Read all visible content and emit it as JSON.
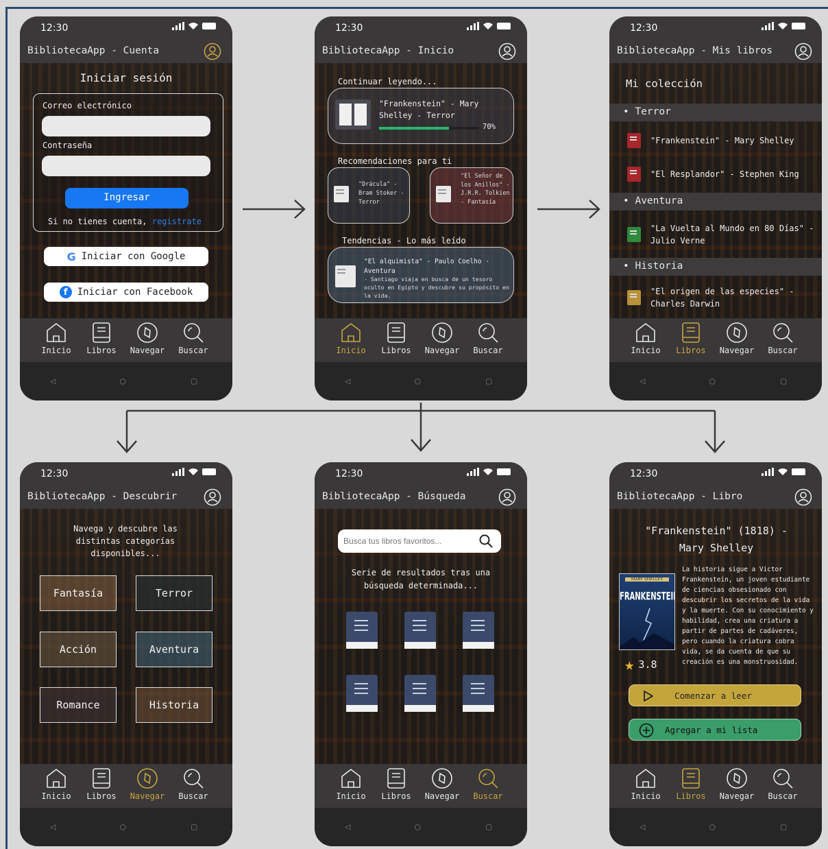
{
  "status": {
    "time": "12:30"
  },
  "nav": {
    "inicio": "Inicio",
    "libros": "Libros",
    "navegar": "Navegar",
    "buscar": "Buscar"
  },
  "screens": {
    "cuenta": {
      "title": "BibliotecaApp - Cuenta",
      "heading": "Iniciar sesión",
      "email_label": "Correo electrónico",
      "password_label": "Contraseña",
      "login_button": "Ingresar",
      "no_account": "Si no tienes cuenta,",
      "register_link": "registrate",
      "google_button": "Iniciar con Google",
      "facebook_button": "Iniciar con Facebook"
    },
    "inicio": {
      "title": "BibliotecaApp - Inicio",
      "continue_heading": "Continuar leyendo...",
      "continue_book": "\"Frankenstein\" - Mary Shelley - Terror",
      "progress_label": "70%",
      "progress": 0.7,
      "rec_heading": "Recomendaciones para ti",
      "rec1": "\"Drácula\" - Bram Stoker - Terror",
      "rec2": "\"El Señor de los Anillos\" - J.R.R. Tolkien - Fantasía",
      "trend_heading": "Tendencias - Lo más leído",
      "trend_title": "\"El alquimista\" - Paulo Coelho - Aventura",
      "trend_desc": "- Santiago viaja en busca de un tesoro oculto en Egipto y descubre su propósito en la vida."
    },
    "libros": {
      "title": "BibliotecaApp - Mis libros",
      "heading": "Mi colección",
      "sections": [
        {
          "name": "• Terror",
          "items": [
            "\"Frankenstein\" - Mary Shelley",
            "\"El Resplandor\" - Stephen King"
          ]
        },
        {
          "name": "• Aventura",
          "items": [
            "\"La Vuelta al Mundo en 80 Días\" - Julio Verne"
          ]
        },
        {
          "name": "• Historia",
          "items": [
            "\"El origen de las especies\" - Charles Darwin"
          ]
        }
      ]
    },
    "descubrir": {
      "title": "BibliotecaApp - Descubrir",
      "intro": "Navega y descubre las distintas categorías disponibles...",
      "categories": [
        "Fantasía",
        "Terror",
        "Acción",
        "Aventura",
        "Romance",
        "Historia"
      ]
    },
    "busqueda": {
      "title": "BibliotecaApp - Búsqueda",
      "search_placeholder": "Busca tus libros favoritos...",
      "results_text": "Serie de resultados tras una búsqueda determinada..."
    },
    "libro": {
      "title": "BibliotecaApp - Libro",
      "book_title": "\"Frankenstein\" (1818) - Mary Shelley",
      "cover_author": "MARY SHELLEY",
      "cover_title": "FRANKENSTEIN",
      "description": "La historia sigue a Victor Frankenstein, un joven estudiante de ciencias obsesionado con descubrir los secretos de la vida y la muerte. Con su conocimiento y habilidad, crea una criatura a partir de partes de cadáveres, pero cuando la criatura cobra vida, se da cuenta de que su creación es una monstruosidad.",
      "rating": "3.8",
      "read_button": "Comenzar a leer",
      "add_button": "Agregar a mi lista"
    }
  },
  "colors": {
    "accent": "#c9a443",
    "login": "#1877f2",
    "add_green": "#3a9d6a",
    "read_gold": "#c4a53c",
    "bar": "#3a3838"
  }
}
